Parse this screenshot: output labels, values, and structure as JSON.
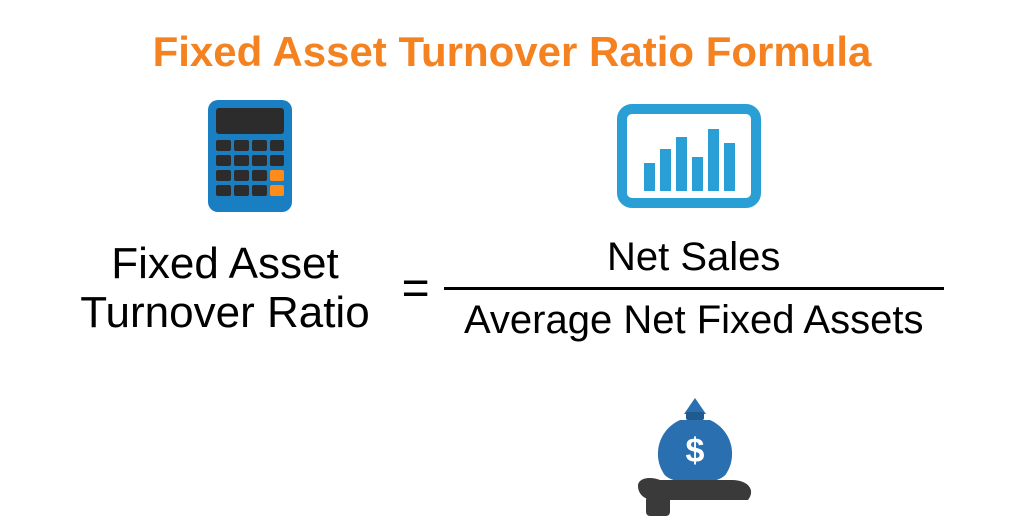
{
  "title": "Fixed Asset Turnover Ratio Formula",
  "formula": {
    "lhs_line1": "Fixed Asset",
    "lhs_line2": "Turnover Ratio",
    "equals": "=",
    "numerator": "Net Sales",
    "denominator": "Average Net Fixed Assets"
  },
  "icons": {
    "calculator": "calculator-icon",
    "chart": "chart-icon",
    "money_bag_hand": "money-bag-hand-icon"
  },
  "colors": {
    "title": "#f58220",
    "text": "#000000",
    "calc_body": "#1a7fc2",
    "calc_dark": "#2c2c2c",
    "chart_blue": "#2a9fd6",
    "bag_blue": "#2a6fb0",
    "hand_dark": "#3a3a3a"
  }
}
